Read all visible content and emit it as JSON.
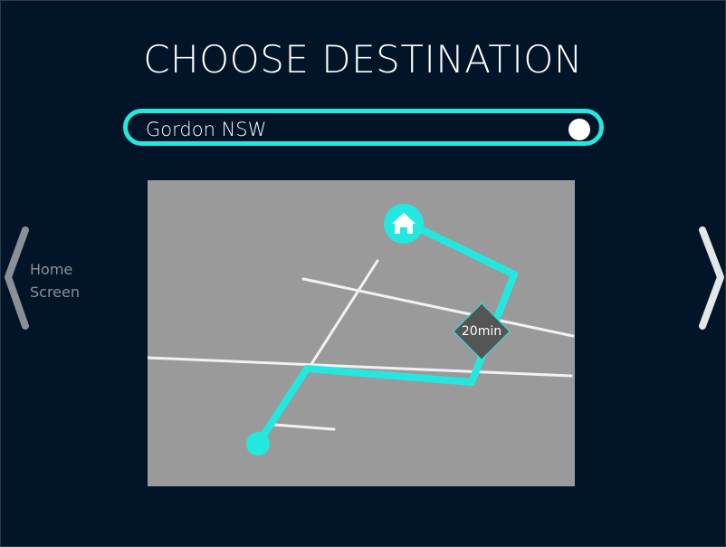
{
  "screen": {
    "title": "CHOOSE DESTINATION"
  },
  "search": {
    "value": "Gordon NSW"
  },
  "navigation": {
    "back_line1": "Home",
    "back_line2": "Screen",
    "back_icon": "chevron-left-icon",
    "forward_icon": "chevron-right-icon"
  },
  "map": {
    "eta": "20min",
    "destination_icon": "home-icon",
    "origin_icon": "location-dot-icon"
  },
  "colors": {
    "background": "#021427",
    "accent": "#22e8e0",
    "map_background": "#9a9a9a",
    "badge": "#555555"
  }
}
